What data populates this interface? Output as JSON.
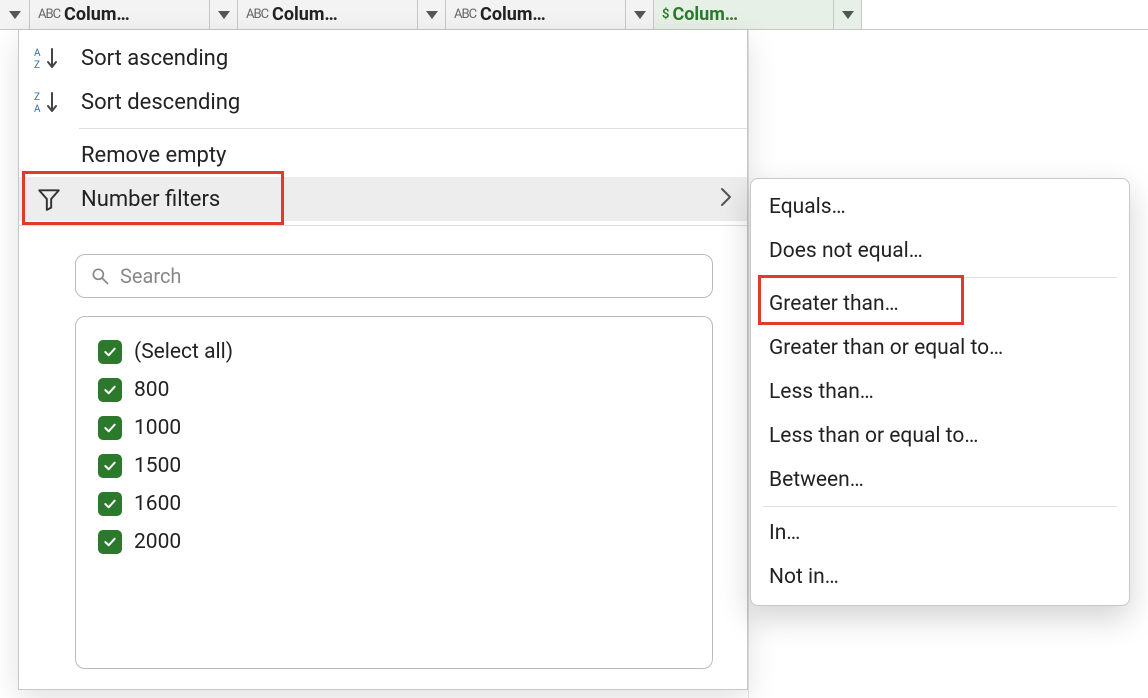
{
  "columns": [
    {
      "type": "ABC",
      "label": "Colum…"
    },
    {
      "type": "ABC",
      "label": "Colum…"
    },
    {
      "type": "ABC",
      "label": "Colum…"
    },
    {
      "type": "$",
      "label": "Colum…",
      "selected": true
    }
  ],
  "menu": {
    "sort_asc": "Sort ascending",
    "sort_desc": "Sort descending",
    "remove_empty": "Remove empty",
    "number_filters": "Number filters"
  },
  "search": {
    "placeholder": "Search"
  },
  "values": [
    {
      "label": "(Select all)",
      "checked": true
    },
    {
      "label": "800",
      "checked": true
    },
    {
      "label": "1000",
      "checked": true
    },
    {
      "label": "1500",
      "checked": true
    },
    {
      "label": "1600",
      "checked": true
    },
    {
      "label": "2000",
      "checked": true
    }
  ],
  "submenu": {
    "equals": "Equals…",
    "does_not_equal": "Does not equal…",
    "greater_than": "Greater than…",
    "gte": "Greater than or equal to…",
    "less_than": "Less than…",
    "lte": "Less than or equal to…",
    "between": "Between…",
    "in": "In…",
    "not_in": "Not in…"
  }
}
